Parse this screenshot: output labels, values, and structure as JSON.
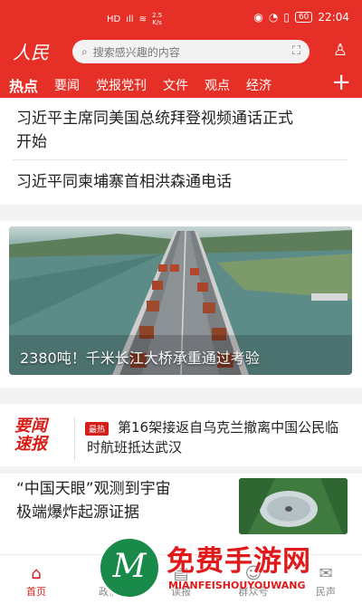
{
  "status_bar": {
    "left": "HD",
    "net_top": "2.5",
    "net_bottom": "K/s",
    "battery": "60",
    "time": "22:04"
  },
  "app": {
    "logo": "人民",
    "search_placeholder": "搜索感兴趣的内容"
  },
  "tabs": [
    "热点",
    "要闻",
    "党报党刊",
    "文件",
    "观点",
    "经济"
  ],
  "headlines": [
    {
      "line1": "习近平主席同美国总统拜登视频通话正式",
      "line2": "开始"
    },
    {
      "line1": "习近平同柬埔寨首相洪森通电话",
      "line2": ""
    }
  ],
  "hero": {
    "caption": "2380吨！千米长江大桥承重通过考验"
  },
  "flash": {
    "logo_line1": "要闻",
    "logo_line2": "速报",
    "badge": "最热",
    "text": "第16架接返自乌克兰撤离中国公民临时航班抵达武汉"
  },
  "card2": {
    "line1": "“中国天眼”观测到宇宙",
    "line2": "极端爆炸起源证据"
  },
  "bottom_nav": [
    {
      "label": "首页",
      "icon": "home-icon"
    },
    {
      "label": "政情",
      "icon": "flag-icon"
    },
    {
      "label": "读报",
      "icon": "newspaper-icon"
    },
    {
      "label": "群众号",
      "icon": "people-icon"
    },
    {
      "label": "民声",
      "icon": "chat-icon"
    }
  ],
  "watermark": {
    "big": "免费手游网",
    "small": "MIANFEISHOUYOUWANG"
  },
  "colors": {
    "brand_red": "#e63027",
    "accent": "#d51e18"
  }
}
